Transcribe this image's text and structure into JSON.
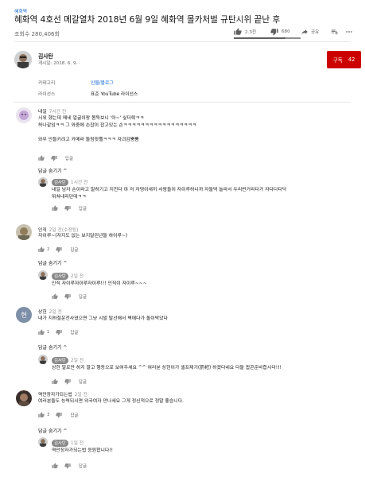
{
  "video": {
    "tag": "혜화역",
    "title": "혜화역 4호선 메갈열차 2018년 6월 9일 혜화역 몰카처벌 규탄시위 끝난 후",
    "views": "조회수 280,406회",
    "like_count": "2.3천",
    "dislike_count": "680",
    "share_label": "공유",
    "colors": {
      "accent": "#065fd4",
      "subscribe": "#cc0000",
      "chip": "#888888"
    }
  },
  "channel": {
    "name": "김사탄",
    "date": "게시일: 2018. 6. 9.",
    "subscribe_label": "구독",
    "subscribe_count": "42",
    "category_label": "카테고리",
    "category_value": "인물/블로그",
    "license_label": "라이선스",
    "license_value": "표준 YouTube 라이선스"
  },
  "comments": [
    {
      "author": "내일",
      "time": "7시간 전",
      "lines": [
        "시위 했는데 메네 얼굴이랑 몸둑보니 '아~' 싶더랔ㅋㅋ",
        "하나같임ㅋㅋ 그 와중에 손잡이 잡고있는 손ㅋㅋㅋㅋㅋㅋㅋㅋㅋㅋㅋㅋㅋㅋㅋㅋㅋ",
        "",
        "와무 안들키려고 카메라 돌림뒷펠ㅋㅋㅋ 자괴감뿜뿜"
      ],
      "likes": "",
      "reply_label": "답글",
      "hide_label": "답글 숨기기 ^",
      "reply": {
        "author": "김사탄",
        "time": "1시간 전",
        "lines": [
          "내일 남자 손이라고 말하기고 지친다 야 저 자댕이새끼 사람들이 자이루하니까 자들딱 놀라서 두리번거리다가 자다다다닥",
          "뛰쳐내리던데ㅋㅋ"
        ],
        "reply_label": "답글"
      }
    },
    {
      "author": "인직",
      "time": "2일 전(수정됨)",
      "lines": [
        "자이루~(자지도 없는 보지달린년들 하이루~)"
      ],
      "likes": "2",
      "reply_label": "답글",
      "hide_label": "답글 숨기기 ^",
      "reply": {
        "author": "김사탄",
        "time": "2일 전",
        "lines": [
          "인직 자이루자이루자이루!!! 인직이 자이루~~~"
        ],
        "reply_label": "답글"
      }
    },
    {
      "author": "상헌",
      "time": "2일 전",
      "lines": [
        "내가 지하철운전사였으면 그냥 시발 탈선해서 벽에다가 돌이박았다"
      ],
      "likes": "1",
      "reply_label": "답글",
      "hide_label": "답글 숨기기 ^",
      "reply": {
        "author": "김사탄",
        "time": "2일 전",
        "lines": [
          "상헌 말로만 하지 말고 행동으로 보여주세요 ^^ 여러분 상헌이가 셀프제기(罰祀) 하겠다네요 다들 팝콘준비합시다!!!"
        ],
        "reply_label": "답글"
      }
    },
    {
      "author": "역만장자가되는법",
      "time": "2일 전",
      "lines": [
        "여러분들도 능력되시면 외국여자 만나세요 그게 정신적으로 정말 좋습니다."
      ],
      "likes": "3",
      "reply_label": "답글",
      "hide_label": "답글 숨기기 ^",
      "reply": {
        "author": "김사탄",
        "time": "1일 전",
        "lines": [
          "역만장자가되는법 응원합니다!!"
        ],
        "reply_label": "답글"
      }
    }
  ],
  "icons": [
    "thumb-up-icon",
    "thumb-down-icon",
    "share-icon",
    "add-to-playlist-icon",
    "more-icon",
    "channel-avatar",
    "user-avatar"
  ]
}
